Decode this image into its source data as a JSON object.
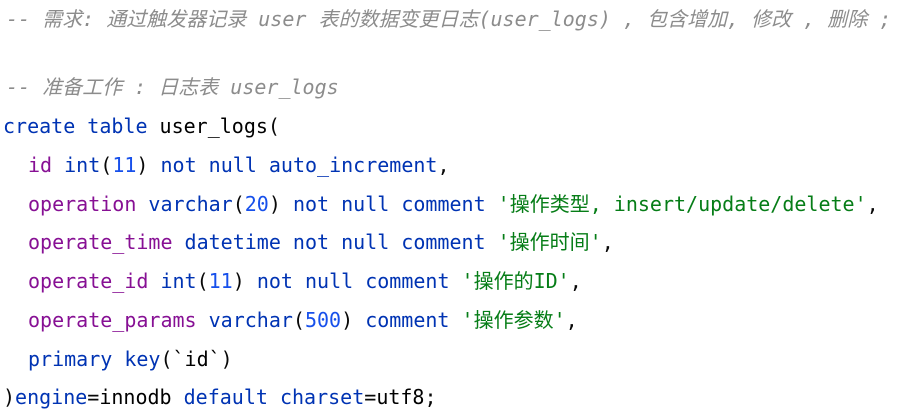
{
  "editor": {
    "comment_requirement": "-- 需求: 通过触发器记录 user 表的数据变更日志(user_logs) , 包含增加, 修改 , 删除 ;",
    "comment_prepare": "-- 准备工作 : 日志表 user_logs",
    "create_kw": "create table",
    "table_name": "user_logs",
    "open_paren": "(",
    "col_id": {
      "name": "id",
      "type": "int",
      "len_open": "(",
      "len": "11",
      "len_close": ")",
      "rest": "not null auto_increment",
      "end": ","
    },
    "col_operation": {
      "name": "operation",
      "type": "varchar",
      "len_open": "(",
      "len": "20",
      "len_close": ")",
      "rest": "not null comment",
      "str": "'操作类型, insert/update/delete'",
      "end": ","
    },
    "col_operate_time": {
      "name": "operate_time",
      "type": "datetime",
      "rest": "not null comment",
      "str": "'操作时间'",
      "end": ","
    },
    "col_operate_id": {
      "name": "operate_id",
      "type": "int",
      "len_open": "(",
      "len": "11",
      "len_close": ")",
      "rest": "not null comment",
      "str": "'操作的ID'",
      "end": ","
    },
    "col_operate_params": {
      "name": "operate_params",
      "type": "varchar",
      "len_open": "(",
      "len": "500",
      "len_close": ")",
      "rest": "comment",
      "str": "'操作参数'",
      "end": ","
    },
    "primary_key": {
      "kw": "primary key",
      "open": "(",
      "col": "`id`",
      "close": ")"
    },
    "closing": {
      "paren": ")",
      "engine_kw": "engine",
      "eq1": "=",
      "engine_val": "innodb",
      "default_kw": "default charset",
      "eq2": "=",
      "charset_val": "utf8",
      "semi": ";"
    }
  }
}
